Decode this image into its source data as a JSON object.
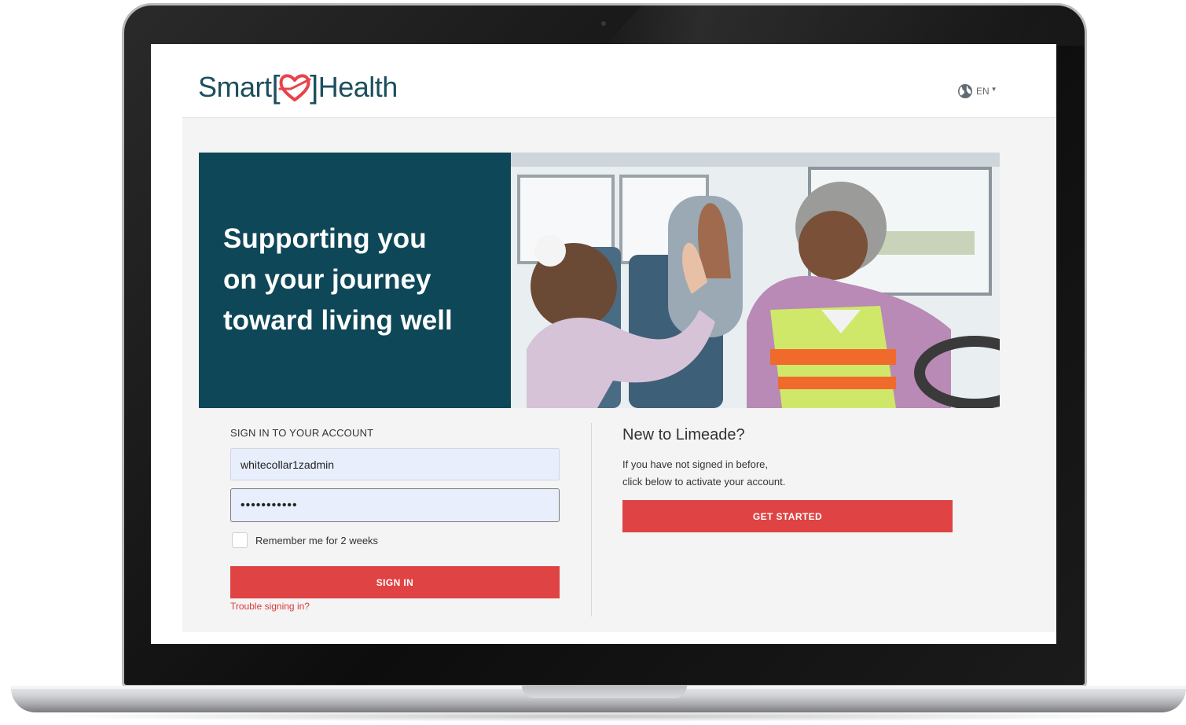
{
  "brand": {
    "logo_smart": "Smart",
    "logo_health": "Health",
    "color_primary": "#0e4757",
    "color_accent": "#df4343"
  },
  "header": {
    "language": "EN",
    "language_icon": "globe-icon"
  },
  "hero": {
    "title": "Supporting you\non your journey\ntoward living well",
    "photo": "bus-driver-high-five-photo"
  },
  "signin": {
    "heading": "SIGN IN TO YOUR ACCOUNT",
    "username_value": "whitecollar1zadmin",
    "password_value": "•••••••••••",
    "remember_label": "Remember me for 2 weeks",
    "remember_checked": false,
    "submit_label": "SIGN IN",
    "trouble_link": "Trouble signing in?"
  },
  "new_user": {
    "title": "New to Limeade?",
    "description": "If you have not signed in before,\nclick below to activate your account.",
    "button_label": "GET STARTED"
  }
}
